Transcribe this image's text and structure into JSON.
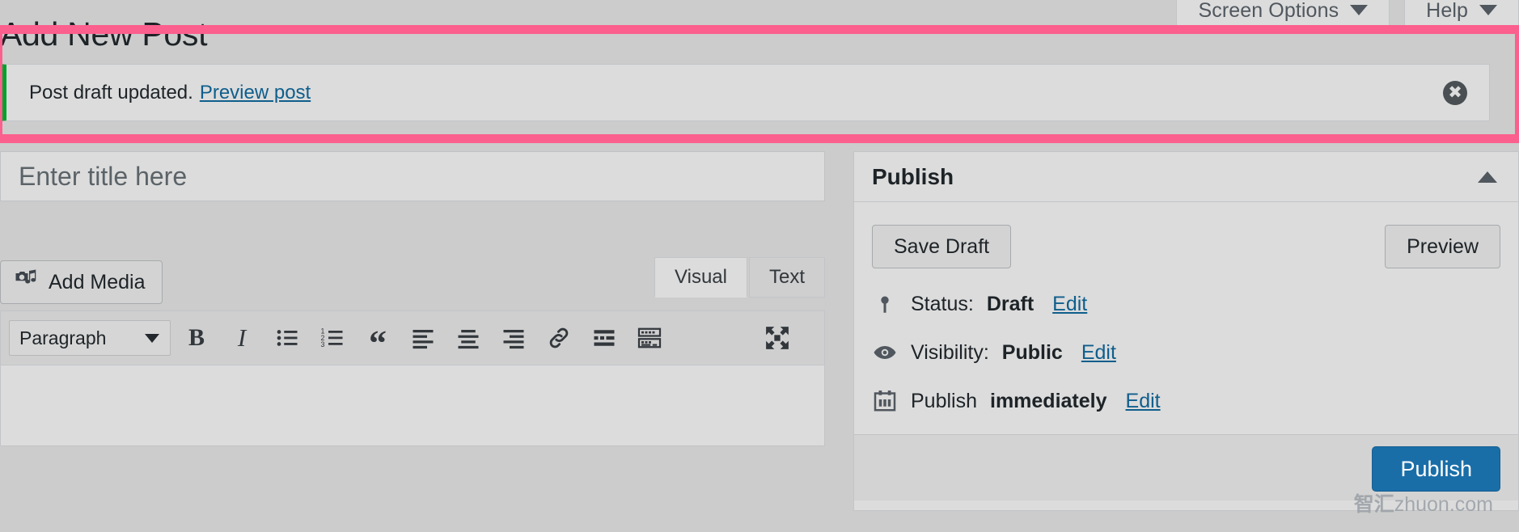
{
  "screen_meta": {
    "screen_options_label": "Screen Options",
    "help_label": "Help"
  },
  "page": {
    "title": "Add New Post"
  },
  "notice": {
    "message": "Post draft updated.",
    "link_label": "Preview post",
    "dismiss_icon": "close-circle-icon",
    "accent_color": "#00a32a"
  },
  "highlight": {
    "color": "#fb5f8d"
  },
  "editor": {
    "title_placeholder": "Enter title here",
    "title_value": "",
    "add_media_label": "Add Media",
    "add_media_icon": "media-camera-music-icon",
    "tabs": [
      {
        "label": "Visual",
        "active": true
      },
      {
        "label": "Text",
        "active": false
      }
    ],
    "toolbar": {
      "format_select_value": "Paragraph",
      "buttons": [
        {
          "name": "bold-icon",
          "glyph": "B"
        },
        {
          "name": "italic-icon",
          "glyph": "I"
        },
        {
          "name": "bulleted-list-icon",
          "glyph": ""
        },
        {
          "name": "numbered-list-icon",
          "glyph": ""
        },
        {
          "name": "blockquote-icon",
          "glyph": "“"
        },
        {
          "name": "align-left-icon",
          "glyph": ""
        },
        {
          "name": "align-center-icon",
          "glyph": ""
        },
        {
          "name": "align-right-icon",
          "glyph": ""
        },
        {
          "name": "insert-link-icon",
          "glyph": ""
        },
        {
          "name": "read-more-icon",
          "glyph": ""
        },
        {
          "name": "toolbar-toggle-icon",
          "glyph": ""
        }
      ],
      "distraction_free_icon": "fullscreen-expand-icon"
    }
  },
  "publish_box": {
    "title": "Publish",
    "toggle_icon": "chevron-up-icon",
    "save_draft_label": "Save Draft",
    "preview_label": "Preview",
    "status": {
      "icon": "pin-icon",
      "label": "Status:",
      "value": "Draft",
      "edit_label": "Edit"
    },
    "visibility": {
      "icon": "eye-icon",
      "label": "Visibility:",
      "value": "Public",
      "edit_label": "Edit"
    },
    "schedule": {
      "icon": "calendar-icon",
      "label": "Publish",
      "value": "immediately",
      "edit_label": "Edit"
    },
    "publish_label": "Publish",
    "publish_color": "#1a6ea8"
  },
  "watermark": {
    "cjk": "智汇",
    "latin": "zhuon.com"
  }
}
